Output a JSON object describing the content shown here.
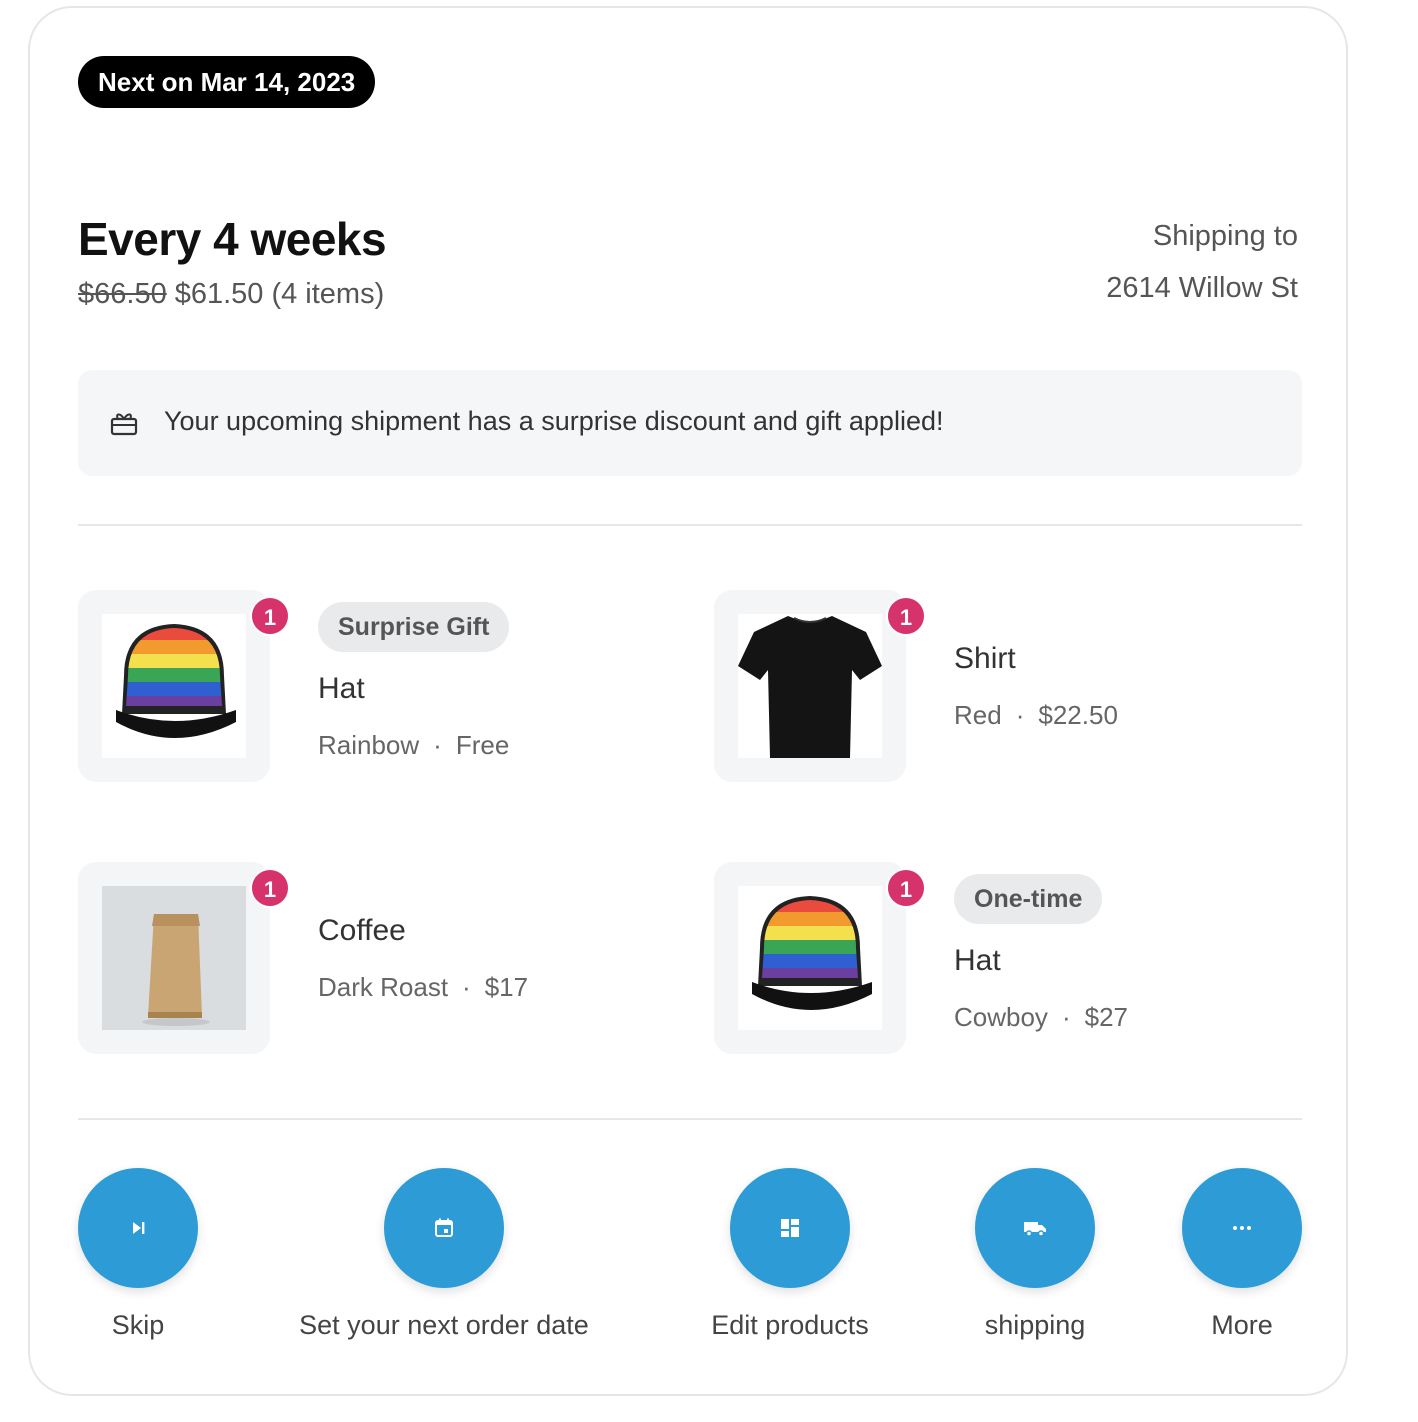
{
  "header": {
    "next_label": "Next on Mar 14, 2023",
    "frequency": "Every 4 weeks",
    "old_price": "$66.50",
    "new_price_line": "$61.50 (4 items)",
    "shipping_label": "Shipping to",
    "shipping_address": "2614 Willow St"
  },
  "notice": {
    "icon": "gift-icon",
    "message": "Your upcoming shipment has a surprise discount and gift applied!"
  },
  "items": [
    {
      "quantity": "1",
      "tag": "Surprise Gift",
      "name": "Hat",
      "variant": "Rainbow",
      "dot": "·",
      "price": "Free"
    },
    {
      "quantity": "1",
      "tag": "",
      "name": "Shirt",
      "variant": "Red",
      "dot": "·",
      "price": "$22.50"
    },
    {
      "quantity": "1",
      "tag": "",
      "name": "Coffee",
      "variant": "Dark Roast",
      "dot": "·",
      "price": "$17"
    },
    {
      "quantity": "1",
      "tag": "One-time",
      "name": "Hat",
      "variant": "Cowboy",
      "dot": "·",
      "price": "$27"
    }
  ],
  "actions": [
    {
      "label": "Skip",
      "icon": "skip-icon"
    },
    {
      "label": "Set your next order date",
      "icon": "calendar-icon"
    },
    {
      "label": "Edit products",
      "icon": "dashboard-icon"
    },
    {
      "label": "shipping",
      "icon": "truck-icon"
    },
    {
      "label": "More",
      "icon": "more-icon"
    }
  ],
  "colors": {
    "accent": "#2d9bd6",
    "badge": "#d6336c",
    "pill": "#000000"
  }
}
